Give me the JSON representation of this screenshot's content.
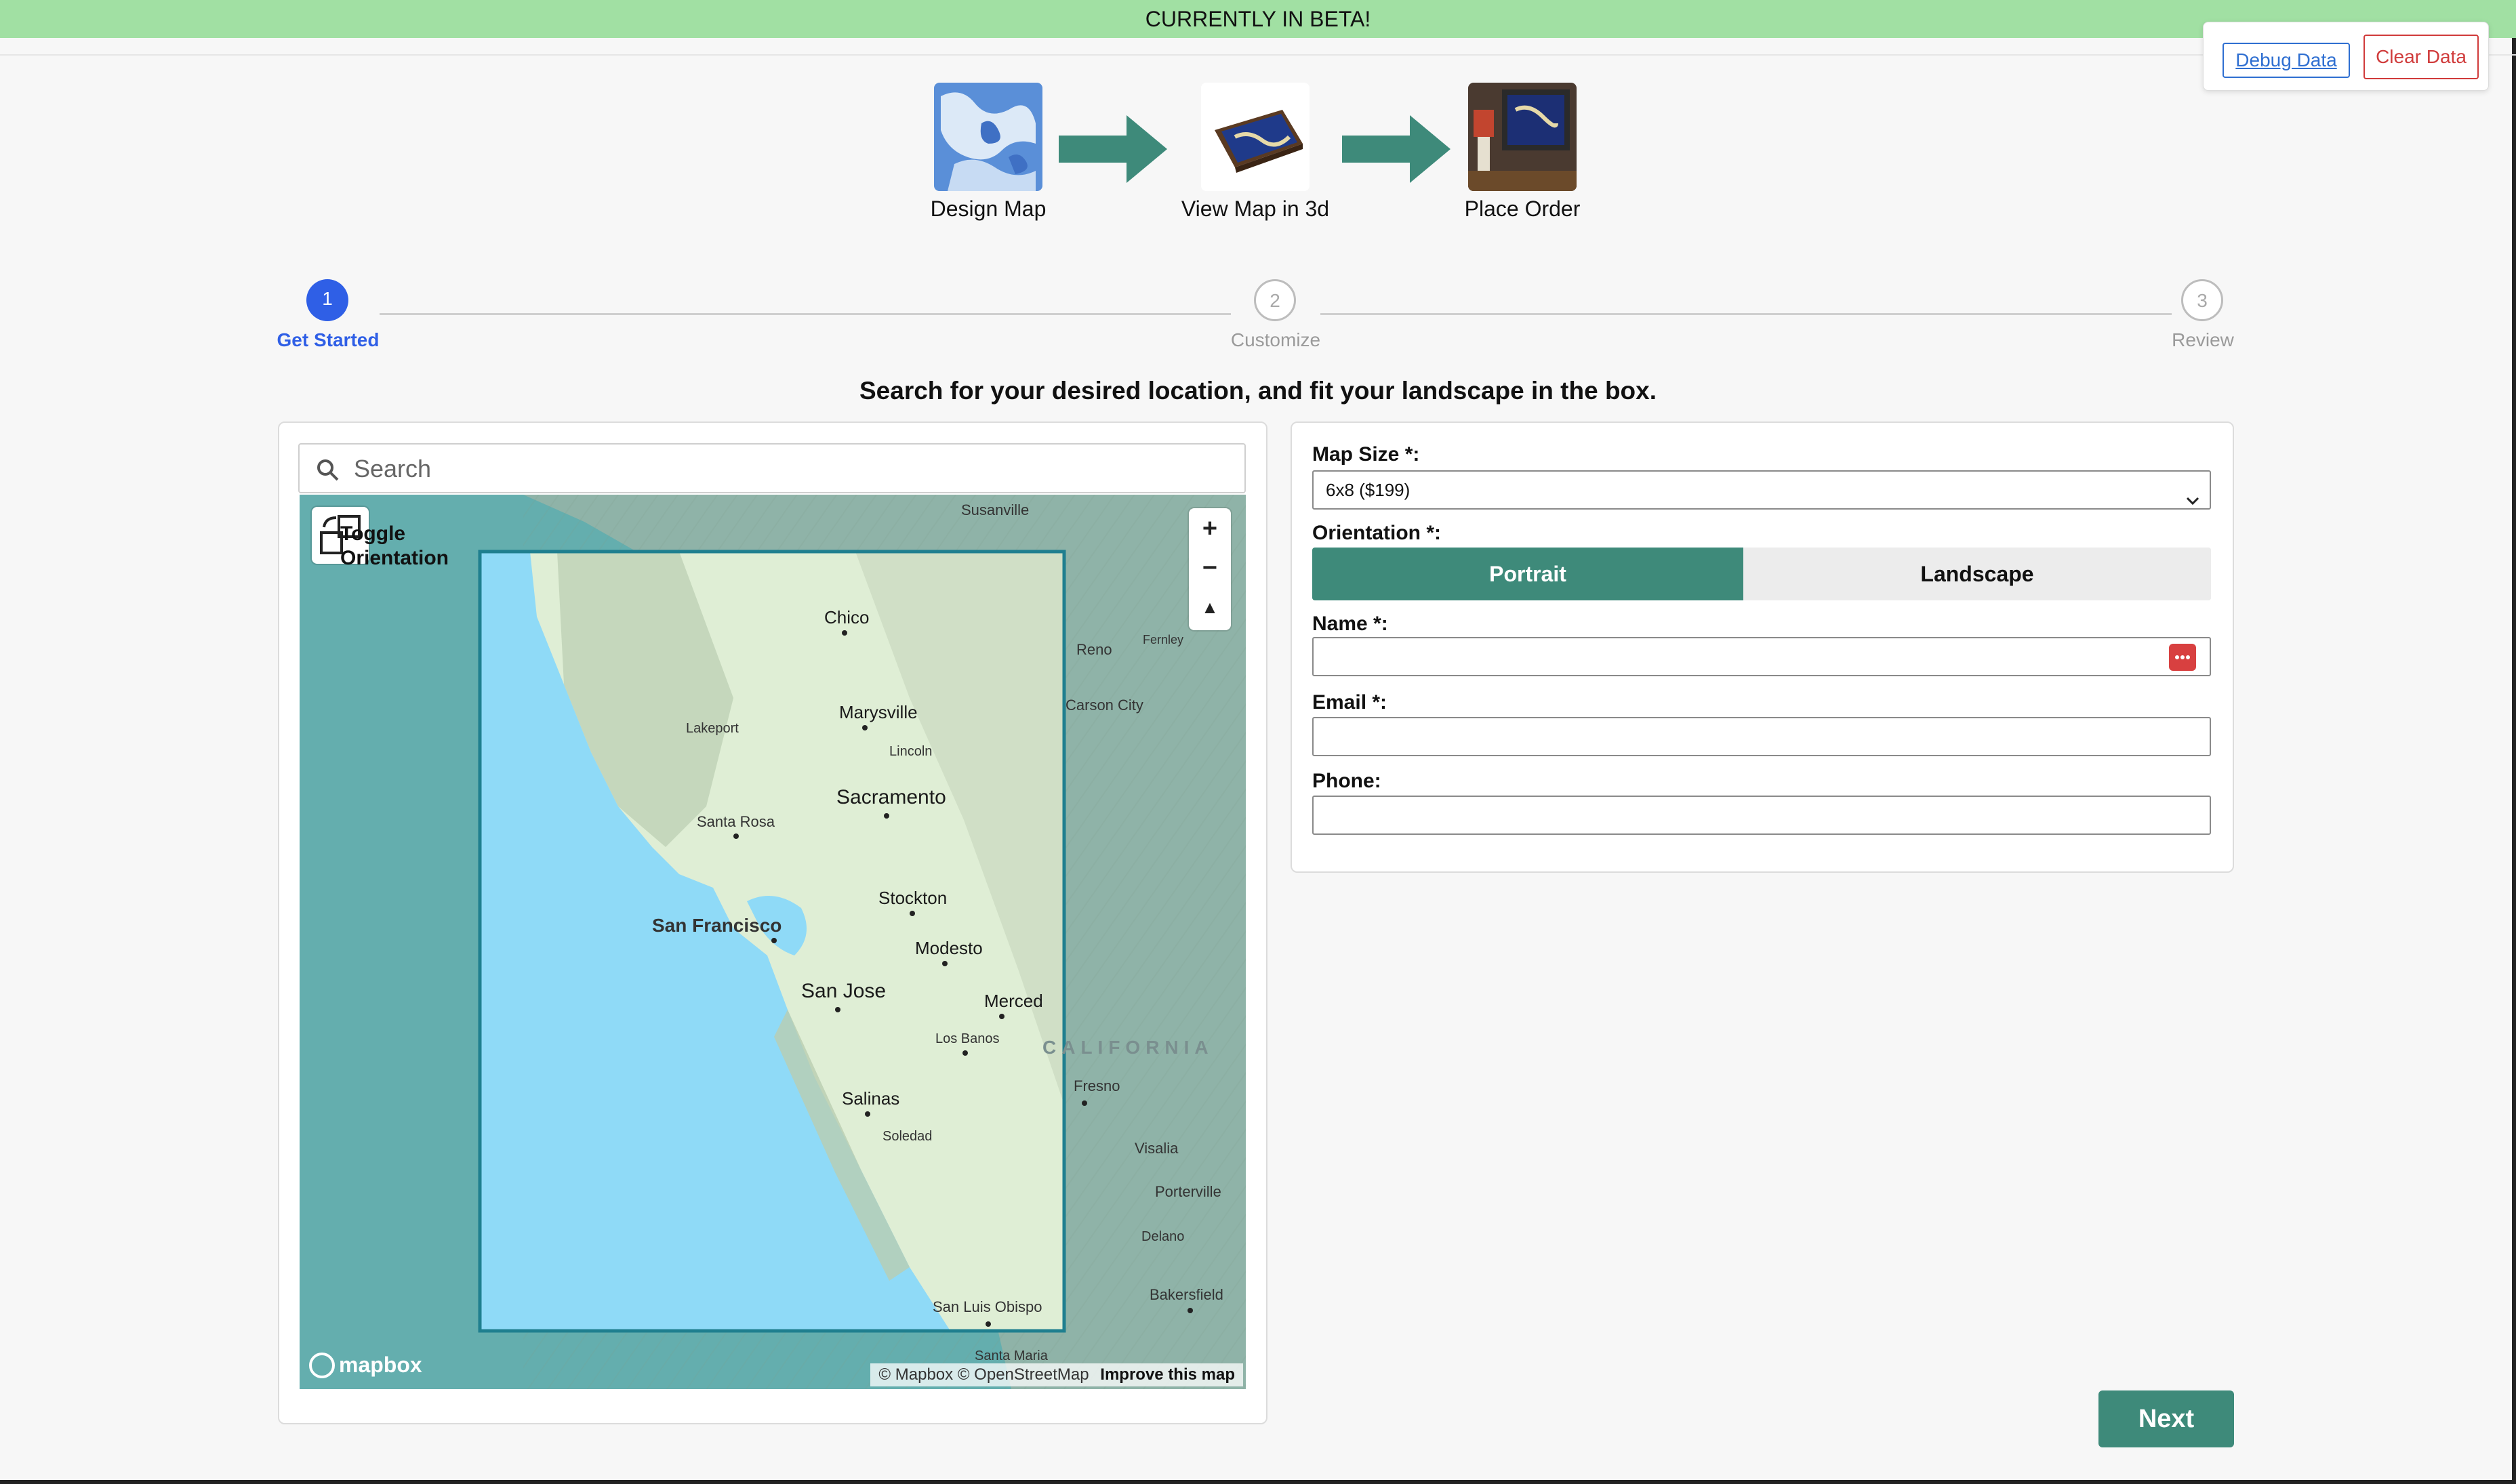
{
  "banner": {
    "text": "CURRENTLY IN BETA!"
  },
  "debug": {
    "debug_label": "Debug Data",
    "clear_label": "Clear Data"
  },
  "flow": {
    "steps": [
      {
        "label": "Design Map"
      },
      {
        "label": "View Map in 3d"
      },
      {
        "label": "Place Order"
      }
    ]
  },
  "stepper": {
    "steps": [
      {
        "number": "1",
        "label": "Get Started",
        "state": "active"
      },
      {
        "number": "2",
        "label": "Customize",
        "state": "idle"
      },
      {
        "number": "3",
        "label": "Review",
        "state": "idle"
      }
    ]
  },
  "instructions": "Search for your desired location, and fit your landscape in the box.",
  "search": {
    "placeholder": "Search",
    "value": ""
  },
  "map": {
    "toggle_label": "Toggle Orientation",
    "zoom_in": "+",
    "zoom_out": "−",
    "compass": "▲",
    "region_label": "CALIFORNIA",
    "logo": "mapbox",
    "attribution": "© Mapbox © OpenStreetMap",
    "improve": "Improve this map",
    "cities": [
      "Susanville",
      "Chico",
      "Reno",
      "Fernley",
      "Marysville",
      "Carson City",
      "Lakeport",
      "Lincoln",
      "Sacramento",
      "Santa Rosa",
      "Stockton",
      "San Francisco",
      "Modesto",
      "San Jose",
      "Merced",
      "Los Banos",
      "Fresno",
      "Salinas",
      "Soledad",
      "Visalia",
      "Porterville",
      "Delano",
      "Bakersfield",
      "San Luis Obispo",
      "Santa Maria"
    ]
  },
  "form": {
    "map_size": {
      "label": "Map Size *:",
      "value": "6x8 ($199)"
    },
    "orientation": {
      "label": "Orientation *:",
      "options": [
        "Portrait",
        "Landscape"
      ],
      "selected": "Portrait"
    },
    "name": {
      "label": "Name *:",
      "value": ""
    },
    "email": {
      "label": "Email *:",
      "value": ""
    },
    "phone": {
      "label": "Phone:",
      "value": ""
    }
  },
  "actions": {
    "next_label": "Next"
  },
  "colors": {
    "accent": "#3e8a7a",
    "step_active": "#2f5fe6",
    "banner": "#a1e0a3",
    "debug": "#2f6fd1",
    "danger": "#d03b3b"
  }
}
